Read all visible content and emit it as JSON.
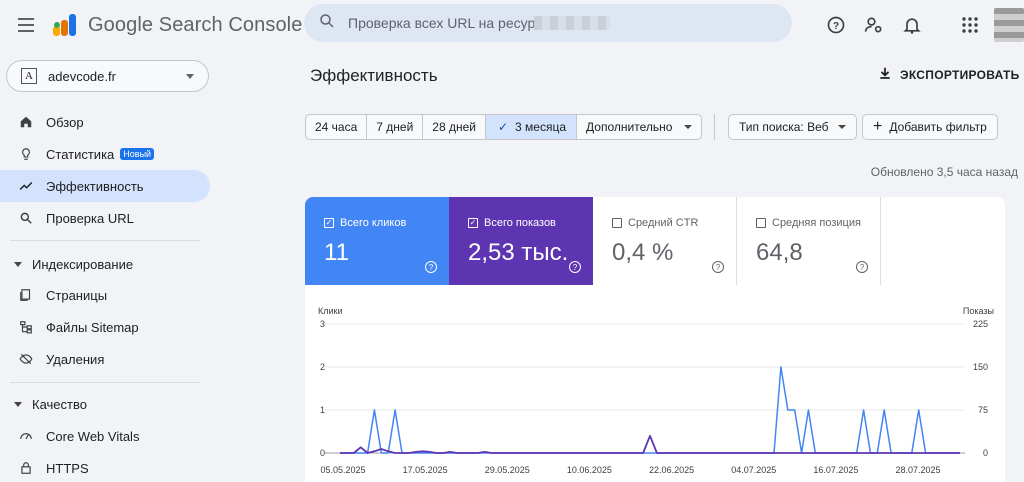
{
  "app": {
    "title": "Google Search Console",
    "search_placeholder": "Проверка всех URL на ресурсе"
  },
  "header_icons": [
    "help-icon",
    "manage-accounts-icon",
    "notifications-icon",
    "apps-grid-icon"
  ],
  "sidebar": {
    "property": "adevcode.fr",
    "items": [
      {
        "label": "Обзор",
        "icon": "home-icon"
      },
      {
        "label": "Статистика",
        "icon": "lightbulb-icon",
        "badge": "Новый"
      },
      {
        "label": "Эффективность",
        "icon": "trending-up-icon",
        "active": true
      },
      {
        "label": "Проверка URL",
        "icon": "search-icon"
      }
    ],
    "sections": [
      {
        "title": "Индексирование",
        "items": [
          {
            "label": "Страницы",
            "icon": "pages-icon"
          },
          {
            "label": "Файлы Sitemap",
            "icon": "sitemap-icon"
          },
          {
            "label": "Удаления",
            "icon": "removal-icon"
          }
        ]
      },
      {
        "title": "Качество",
        "items": [
          {
            "label": "Core Web Vitals",
            "icon": "gauge-icon"
          },
          {
            "label": "HTTPS",
            "icon": "lock-icon"
          }
        ]
      }
    ]
  },
  "main": {
    "title": "Эффективность",
    "export_label": "ЭКСПОРТИРОВАТЬ",
    "date_ranges": [
      "24 часа",
      "7 дней",
      "28 дней",
      "3 месяца"
    ],
    "selected_range": "3 месяца",
    "more_label": "Дополнительно",
    "search_type": "Тип поиска: Веб",
    "add_filter": "Добавить фильтр",
    "updated": "Обновлено 3,5 часа назад"
  },
  "metrics": [
    {
      "label": "Всего кликов",
      "value": "11",
      "checked": true,
      "color": "#4285f4"
    },
    {
      "label": "Всего показов",
      "value": "2,53 тыс.",
      "checked": true,
      "color": "#5e35b1"
    },
    {
      "label": "Средний CTR",
      "value": "0,4 %",
      "checked": false
    },
    {
      "label": "Средняя позиция",
      "value": "64,8",
      "checked": false
    }
  ],
  "chart_data": {
    "type": "line",
    "left_axis_label": "Клики",
    "right_axis_label": "Показы",
    "left_ticks": [
      "3",
      "2",
      "1",
      "0"
    ],
    "right_ticks": [
      "225",
      "150",
      "75",
      "0"
    ],
    "ylim_left": [
      0,
      3
    ],
    "ylim_right": [
      0,
      225
    ],
    "x_ticks": [
      "05.05.2025",
      "17.05.2025",
      "29.05.2025",
      "10.06.2025",
      "22.06.2025",
      "04.07.2025",
      "16.07.2025",
      "28.07.2025"
    ],
    "grid": true,
    "series": [
      {
        "name": "Клики",
        "axis": "left",
        "color": "#4285f4",
        "values": [
          0,
          0,
          0,
          0,
          0,
          1,
          0,
          0,
          1,
          0,
          0,
          0,
          0,
          0,
          0,
          0,
          0,
          0,
          0,
          0,
          0,
          0,
          0,
          0,
          0,
          0,
          0,
          0,
          0,
          0,
          0,
          0,
          0,
          0,
          0,
          0,
          0,
          0,
          0,
          0,
          0,
          0,
          0,
          0,
          0,
          0,
          0,
          0,
          0,
          0,
          0,
          0,
          0,
          0,
          0,
          0,
          0,
          0,
          0,
          0,
          0,
          0,
          0,
          0,
          2,
          1,
          1,
          0,
          1,
          0,
          0,
          0,
          0,
          0,
          0,
          0,
          1,
          0,
          0,
          1,
          0,
          0,
          0,
          0,
          1,
          0,
          0,
          0,
          0,
          0,
          0
        ]
      },
      {
        "name": "Показы",
        "axis": "right",
        "color": "#5e35b1",
        "values": [
          0,
          0,
          0,
          10,
          0,
          3,
          7,
          3,
          0,
          0,
          0,
          2,
          3,
          2,
          0,
          0,
          2,
          0,
          0,
          0,
          0,
          2,
          0,
          0,
          0,
          0,
          0,
          0,
          0,
          0,
          0,
          0,
          0,
          0,
          0,
          0,
          0,
          0,
          0,
          0,
          0,
          0,
          0,
          0,
          0,
          30,
          0,
          0,
          0,
          0,
          0,
          0,
          0,
          0,
          0,
          0,
          0,
          0,
          0,
          0,
          0,
          0,
          0,
          0,
          0,
          0,
          0,
          0,
          0,
          0,
          0,
          0,
          0,
          0,
          0,
          0,
          0,
          0,
          0,
          0,
          0,
          0,
          0,
          0,
          0,
          0,
          0,
          0,
          0,
          0,
          0
        ]
      }
    ]
  }
}
